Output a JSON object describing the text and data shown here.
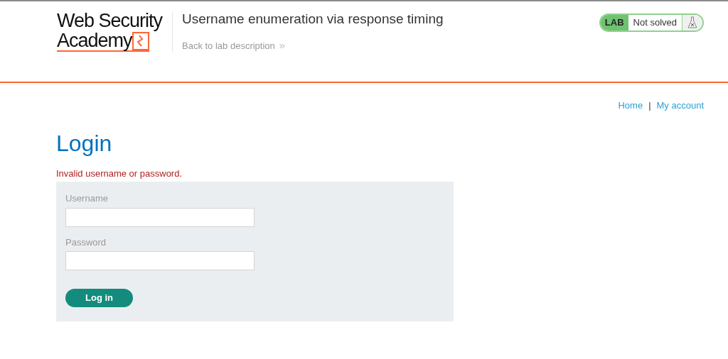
{
  "header": {
    "logo": {
      "line_1": "Web Security",
      "line_2": "Academy"
    },
    "lab_title": "Username enumeration via response timing",
    "back_link": "Back to lab description",
    "back_link_glyph": "»",
    "lab_status": {
      "tag": "LAB",
      "status": "Not solved",
      "solved": false
    }
  },
  "nav": {
    "links": [
      "Home",
      "My account"
    ],
    "separator": "|"
  },
  "page_title": "Login",
  "error_message": "Invalid username or password.",
  "form": {
    "fields": [
      {
        "label": "Username"
      },
      {
        "label": "Password"
      }
    ],
    "submit": "Log in"
  }
}
